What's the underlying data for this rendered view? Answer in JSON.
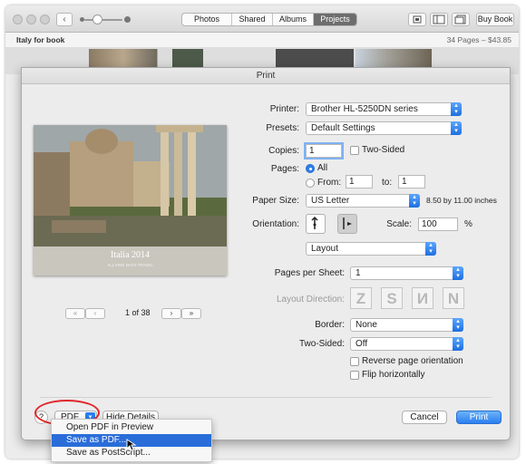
{
  "toolbar": {
    "tabs": [
      {
        "label": "Photos",
        "active": false
      },
      {
        "label": "Shared",
        "active": false
      },
      {
        "label": "Albums",
        "active": false
      },
      {
        "label": "Projects",
        "active": true
      }
    ],
    "buy_book": "Buy Book",
    "back_glyph": "‹"
  },
  "project": {
    "title": "Italy for book",
    "summary": "34 Pages – $43.85"
  },
  "print": {
    "title": "Print",
    "printer_label": "Printer:",
    "printer_value": "Brother HL-5250DN series",
    "presets_label": "Presets:",
    "presets_value": "Default Settings",
    "copies_label": "Copies:",
    "copies_value": "1",
    "two_sided_label": "Two-Sided",
    "pages_label": "Pages:",
    "pages_all": "All",
    "pages_from": "From:",
    "pages_from_value": "1",
    "pages_to": "to:",
    "pages_to_value": "1",
    "paper_size_label": "Paper Size:",
    "paper_size_value": "US Letter",
    "paper_dims": "8.50 by 11.00 inches",
    "orientation_label": "Orientation:",
    "scale_label": "Scale:",
    "scale_value": "100",
    "scale_unit": "%",
    "section_value": "Layout",
    "pages_per_sheet_label": "Pages per Sheet:",
    "pages_per_sheet_value": "1",
    "layout_direction_label": "Layout Direction:",
    "border_label": "Border:",
    "border_value": "None",
    "two_sided_option_label": "Two-Sided:",
    "two_sided_option_value": "Off",
    "reverse_label": "Reverse page orientation",
    "flip_label": "Flip horizontally",
    "preview_caption": "Italia 2014",
    "preview_subcaption": "ALL FINE DAYS TRAVEL",
    "page_counter": "1 of 38",
    "help": "?",
    "pdf_button": "PDF",
    "hide_details": "Hide Details",
    "cancel": "Cancel",
    "print_button": "Print"
  },
  "pdf_menu": {
    "items": [
      {
        "label": "Open PDF in Preview",
        "highlighted": false
      },
      {
        "label": "Save as PDF...",
        "highlighted": true
      },
      {
        "label": "Save as PostScript...",
        "highlighted": false
      }
    ]
  },
  "colors": {
    "accent": "#2a7ff0",
    "highlight": "#2a6dd9",
    "annotation_circle": "#e0262b"
  },
  "icons": [
    "sidebar-icon",
    "share-icon",
    "back-icon",
    "portrait-icon",
    "landscape-icon",
    "help-icon",
    "chevron-down-icon",
    "pointer-cursor-icon"
  ]
}
